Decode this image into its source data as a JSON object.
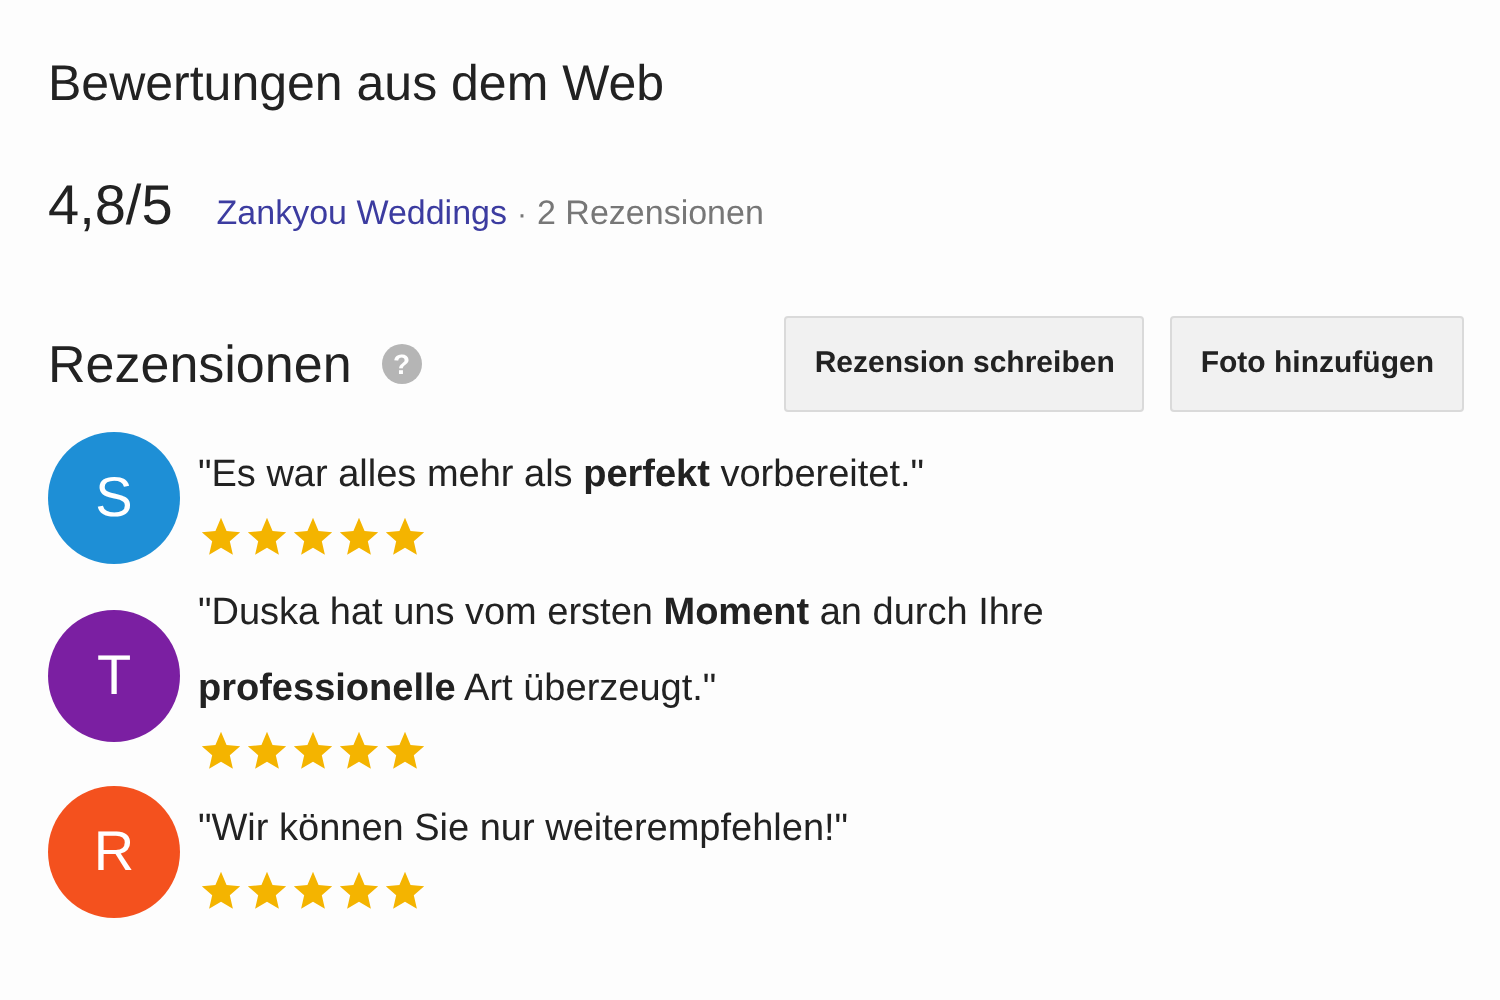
{
  "title": "Bewertungen aus dem Web",
  "rating": {
    "score": "4,8/5",
    "source": "Zankyou Weddings",
    "separator": "·",
    "count": "2 Rezensionen"
  },
  "reviews_header": {
    "title": "Rezensionen",
    "help_icon": "?",
    "buttons": [
      "Rezension schreiben",
      "Foto hinzufügen"
    ]
  },
  "reviews": [
    {
      "initial": "S",
      "color": "#1e8fd6",
      "text": "\"Es war alles mehr als **perfekt** vorbereitet.\"",
      "stars": 5
    },
    {
      "initial": "T",
      "color": "#7b1fa2",
      "text": "\"Duska hat uns vom ersten **Moment** an durch Ihre **professionelle** Art überzeugt.\"",
      "stars": 5
    },
    {
      "initial": "R",
      "color": "#f4511e",
      "text": "\"Wir können Sie nur weiterempfehlen!\"",
      "stars": 5
    }
  ]
}
